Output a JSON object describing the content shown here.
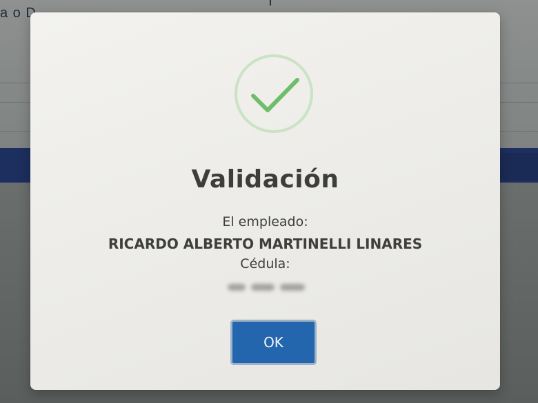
{
  "background": {
    "partial_text": "a o D"
  },
  "dialog": {
    "title": "Validación",
    "employee_label": "El empleado:",
    "employee_name": "RICARDO ALBERTO MARTINELLI LINARES",
    "cedula_label": "Cédula:",
    "ok_label": "OK",
    "icon": "check-icon"
  },
  "colors": {
    "success_green": "#6dbd6a",
    "button_blue": "#2366ad",
    "overlay": "#6f7370"
  }
}
